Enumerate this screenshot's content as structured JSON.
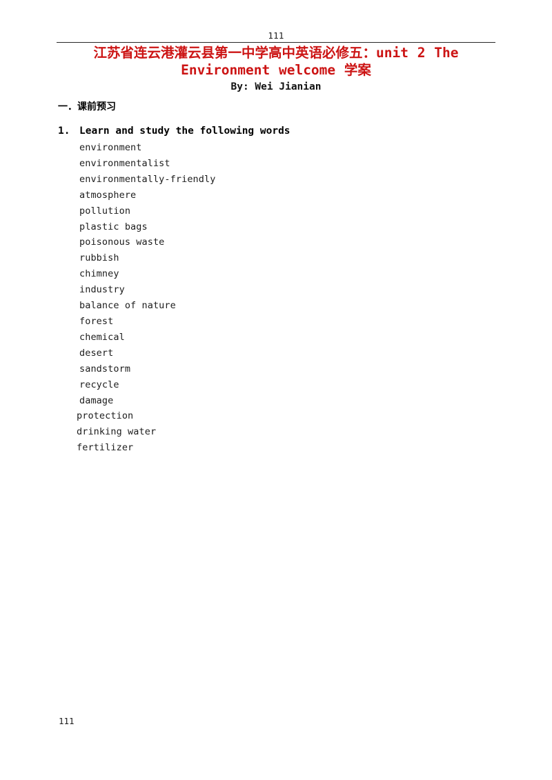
{
  "header": {
    "page_number": "111"
  },
  "title": {
    "line1": "江苏省连云港灌云县第一中学高中英语必修五：unit 2 The",
    "line2": "Environment welcome 学案",
    "byline": "By: Wei Jianian",
    "color": "#cc1414"
  },
  "body": {
    "section_heading": "一．课前预习",
    "task": {
      "number": "1.",
      "text": "Learn and study the following words"
    },
    "words": [
      {
        "text": "environment",
        "outdent": false
      },
      {
        "text": "environmentalist",
        "outdent": false
      },
      {
        "text": "environmentally-friendly",
        "outdent": false
      },
      {
        "text": "atmosphere",
        "outdent": false
      },
      {
        "text": "pollution",
        "outdent": false
      },
      {
        "text": "plastic bags",
        "outdent": false
      },
      {
        "text": "poisonous waste",
        "outdent": false
      },
      {
        "text": "rubbish",
        "outdent": false
      },
      {
        "text": "chimney",
        "outdent": false
      },
      {
        "text": "industry",
        "outdent": false
      },
      {
        "text": "balance of nature",
        "outdent": false
      },
      {
        "text": "forest",
        "outdent": false
      },
      {
        "text": "chemical",
        "outdent": false
      },
      {
        "text": "desert",
        "outdent": false
      },
      {
        "text": "sandstorm",
        "outdent": false
      },
      {
        "text": "recycle",
        "outdent": false
      },
      {
        "text": "damage",
        "outdent": false
      },
      {
        "text": "protection",
        "outdent": true
      },
      {
        "text": "drinking water",
        "outdent": true
      },
      {
        "text": "fertilizer",
        "outdent": true
      }
    ]
  },
  "footer": {
    "page_number": "111"
  }
}
